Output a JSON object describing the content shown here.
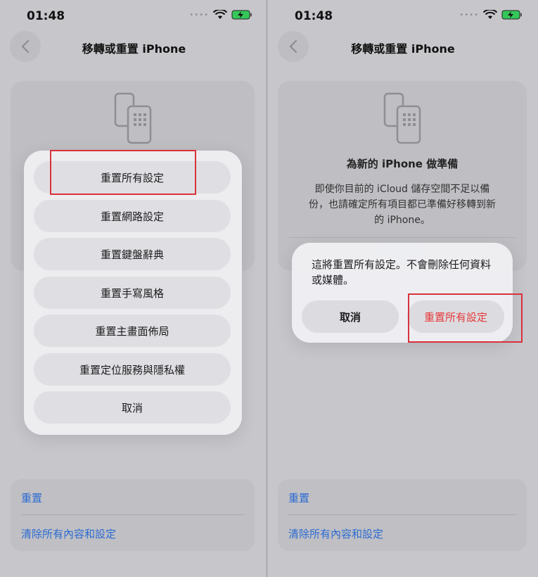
{
  "status": {
    "time": "01:48"
  },
  "nav": {
    "title": "移轉或重置 iPhone"
  },
  "card": {
    "title": "為新的 iPhone 做準備",
    "desc": "即使你目前的 iCloud 儲存空間不足以備份，也請確定所有項目都已準備好移轉到新的 iPhone。"
  },
  "bottom": {
    "reset": "重置",
    "erase": "清除所有內容和設定"
  },
  "sheet": {
    "items": [
      "重置所有設定",
      "重置網路設定",
      "重置鍵盤辭典",
      "重置手寫風格",
      "重置主畫面佈局",
      "重置定位服務與隱私權"
    ],
    "cancel": "取消"
  },
  "alert": {
    "message": "這將重置所有設定。不會刪除任何資料或媒體。",
    "cancel": "取消",
    "confirm": "重置所有設定"
  },
  "colors": {
    "link": "#2c6bd1",
    "destructive": "#e5393b",
    "highlight": "#d9323a"
  }
}
